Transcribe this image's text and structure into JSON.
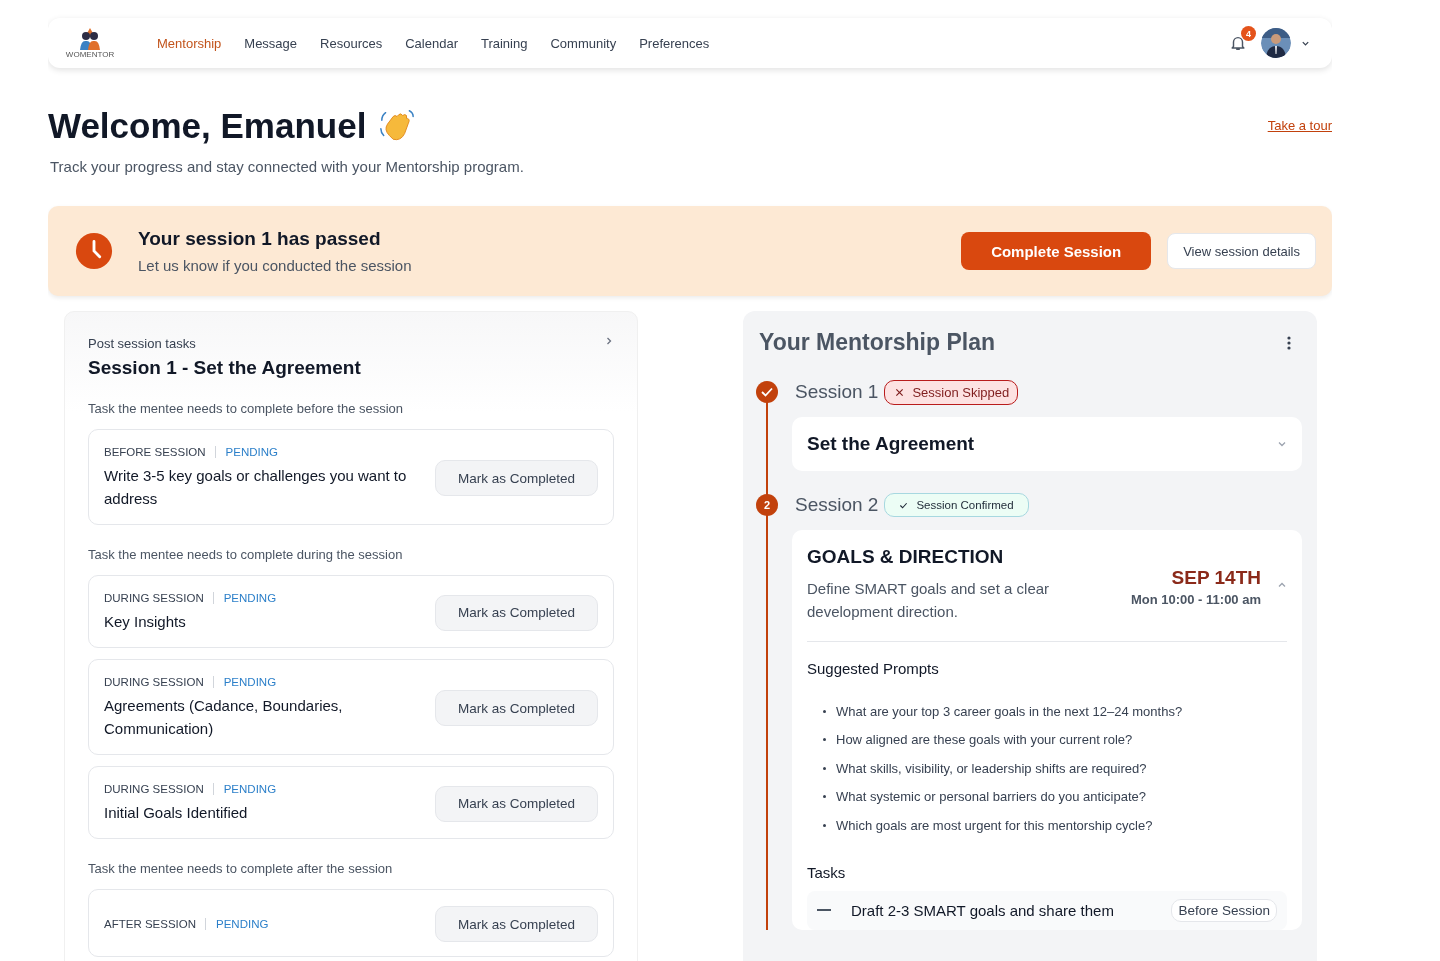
{
  "nav": {
    "logo_text": "WOMENTOR",
    "items": [
      {
        "label": "Mentorship",
        "selected": true
      },
      {
        "label": "Message",
        "selected": false
      },
      {
        "label": "Resources",
        "selected": false
      },
      {
        "label": "Calendar",
        "selected": false
      },
      {
        "label": "Training",
        "selected": false
      },
      {
        "label": "Community",
        "selected": false
      },
      {
        "label": "Preferences",
        "selected": false
      }
    ],
    "notifications": "4"
  },
  "header": {
    "title": "Welcome, Emanuel",
    "subtitle": "Track your progress and stay connected with your Mentorship program.",
    "tour_link": "Take a tour"
  },
  "banner": {
    "title": "Your session 1 has passed",
    "text": "Let us know if you conducted the session",
    "primary_button": "Complete Session",
    "secondary_button": "View session details"
  },
  "post_tasks": {
    "eyebrow": "Post session tasks",
    "title": "Session 1 - Set the Agreement",
    "groups": [
      {
        "caption": "Task the mentee needs to complete before the session",
        "tasks": [
          {
            "phase": "BEFORE SESSION",
            "status": "PENDING",
            "text": "Write 3-5 key goals or challenges you want to address",
            "button": "Mark as Completed"
          }
        ]
      },
      {
        "caption": "Task the mentee needs to complete during the session",
        "tasks": [
          {
            "phase": "DURING SESSION",
            "status": "PENDING",
            "text": "Key Insights",
            "button": "Mark as Completed"
          },
          {
            "phase": "DURING SESSION",
            "status": "PENDING",
            "text": "Agreements (Cadance, Boundaries, Communication)",
            "button": "Mark as Completed"
          },
          {
            "phase": "DURING SESSION",
            "status": "PENDING",
            "text": "Initial Goals Identified",
            "button": "Mark as Completed"
          }
        ]
      },
      {
        "caption": "Task the mentee needs to complete after the session",
        "tasks": [
          {
            "phase": "AFTER SESSION",
            "status": "PENDING",
            "button": "Mark as Completed"
          }
        ]
      }
    ]
  },
  "plan": {
    "title": "Your Mentorship Plan",
    "sessions": [
      {
        "label": "Session 1",
        "marker": {
          "kind": "done"
        },
        "badge": {
          "kind": "skipped",
          "text": "Session Skipped"
        },
        "card": {
          "title": "Set the Agreement",
          "expanded": false
        }
      },
      {
        "label": "Session 2",
        "marker": {
          "kind": "number",
          "text": "2"
        },
        "badge": {
          "kind": "confirmed",
          "text": "Session Confirmed"
        },
        "card": {
          "title": "GOALS & DIRECTION",
          "expanded": true,
          "description": "Define SMART goals and set a clear development direction.",
          "date": "SEP 14TH",
          "time": "Mon 10:00 - 11:00 am",
          "prompts_title": "Suggested Prompts",
          "prompts": [
            "What are your top 3 career goals in the next 12–24 months?",
            "How aligned are these goals with your current role?",
            "What skills, visibility, or leadership shifts are required?",
            "What systemic or personal barriers do you anticipate?",
            "Which goals are most urgent for this mentorship cycle?"
          ],
          "tasks_title": "Tasks",
          "tasks": [
            {
              "text": "Draft 2-3 SMART goals and share them",
              "tag": "Before Session",
              "checked": false
            }
          ]
        }
      }
    ]
  }
}
